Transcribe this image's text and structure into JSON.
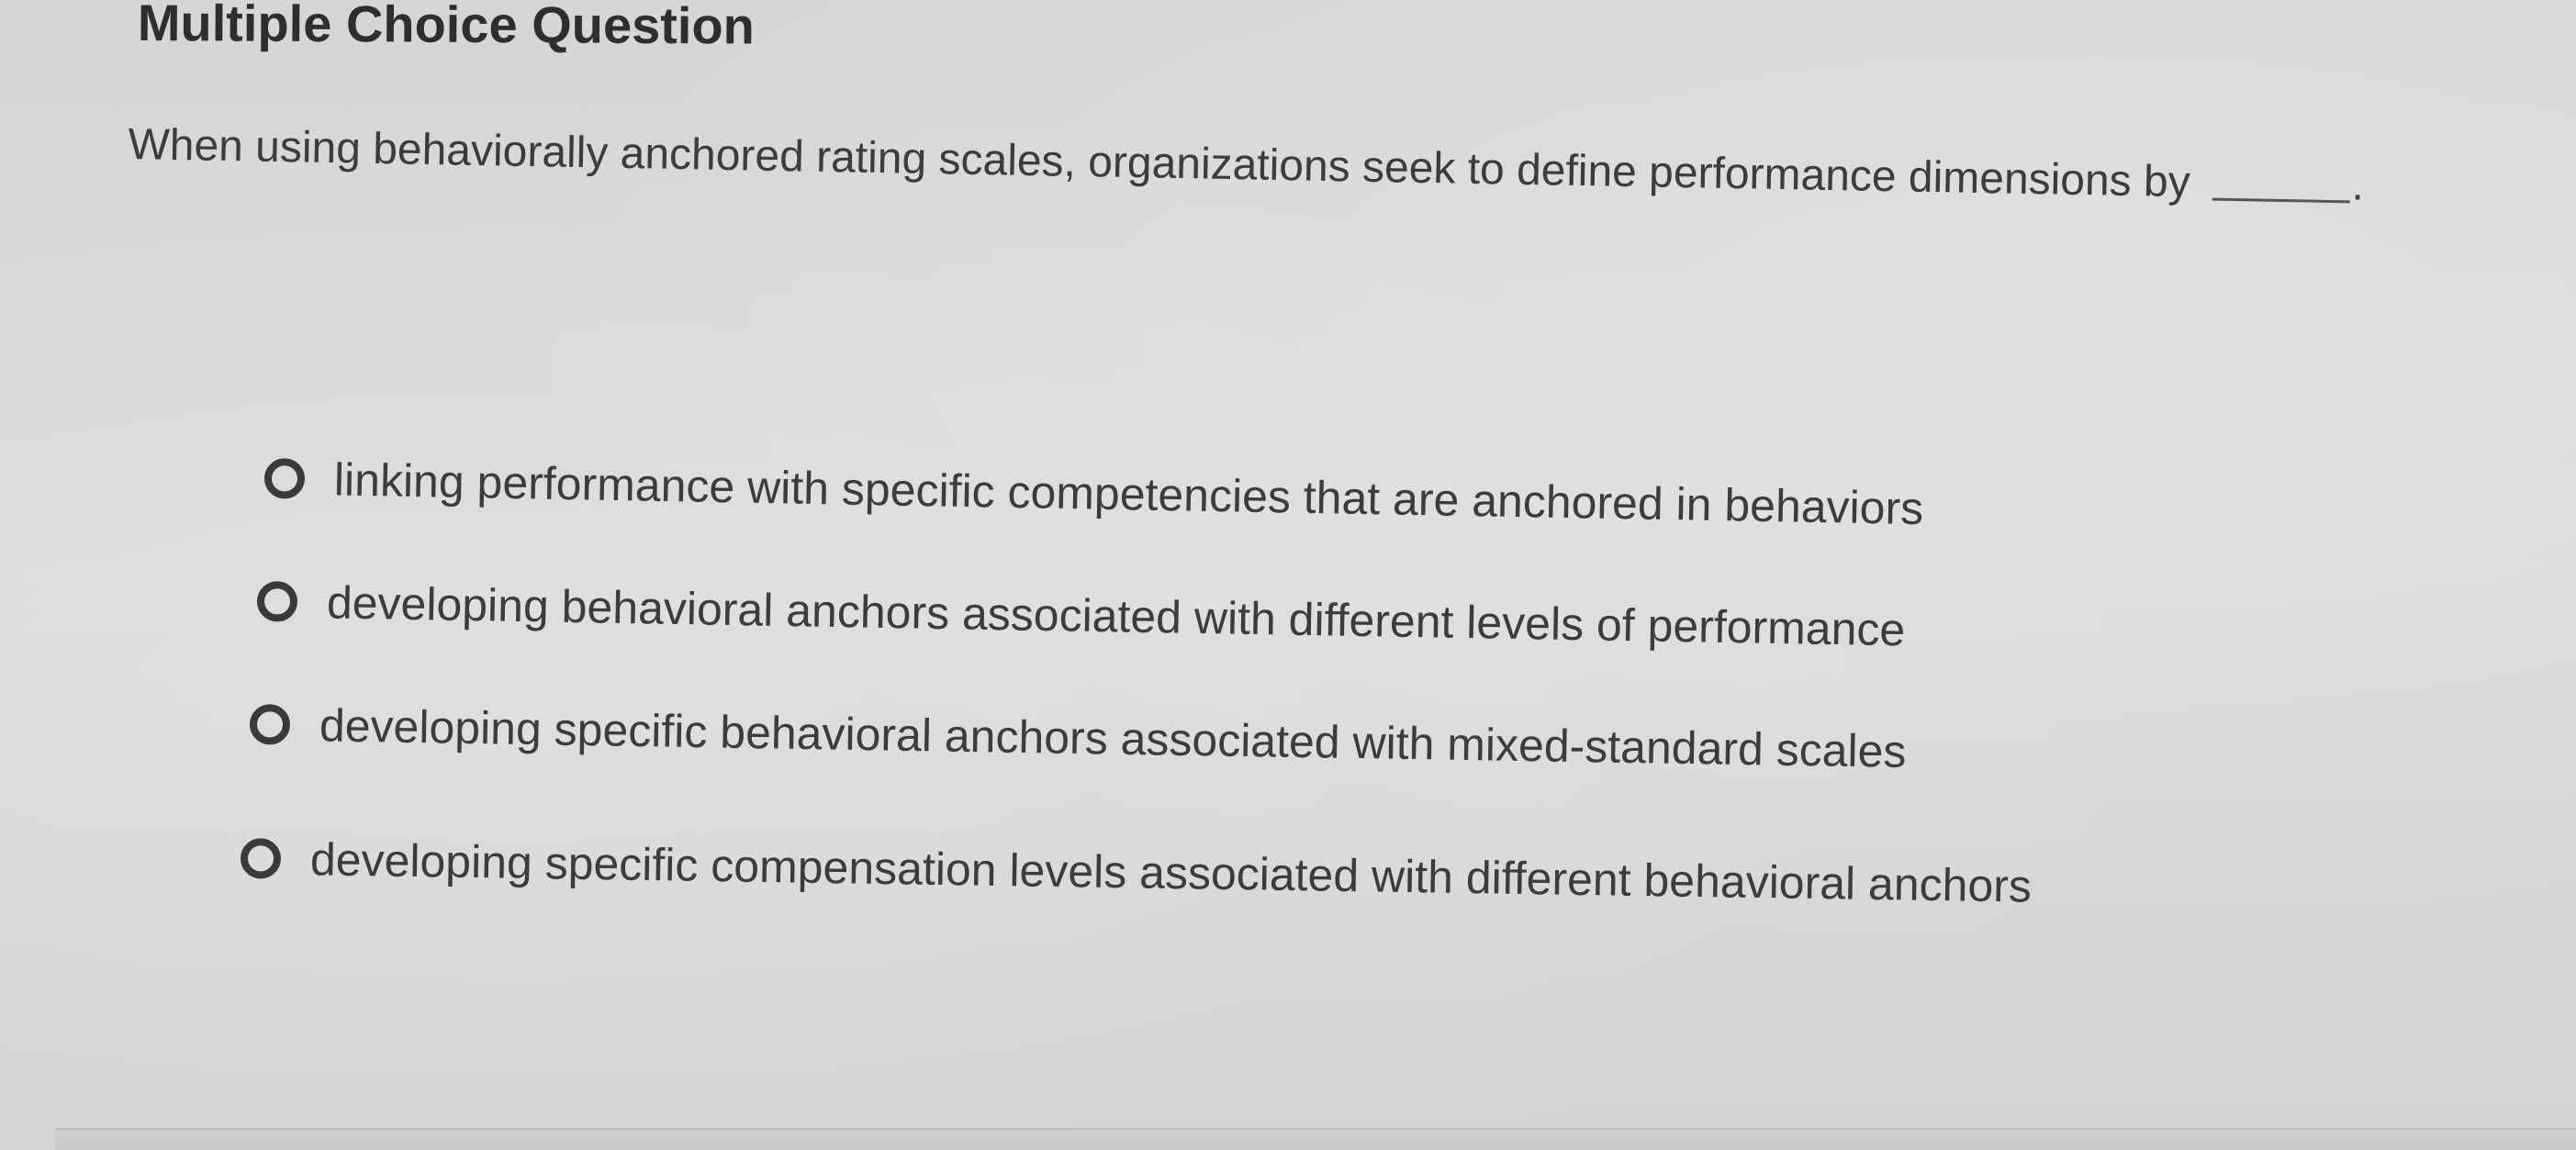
{
  "header": {
    "title": "Multiple Choice Question"
  },
  "question": {
    "text": "When using behaviorally anchored rating scales, organizations seek to define performance dimensions by",
    "end": "."
  },
  "options": [
    {
      "label": "linking performance with specific competencies that are anchored in behaviors",
      "selected": false
    },
    {
      "label": "developing behavioral anchors associated with different levels of performance",
      "selected": false
    },
    {
      "label": "developing specific behavioral anchors associated with mixed-standard scales",
      "selected": false
    },
    {
      "label": "developing specific compensation levels associated with different behavioral anchors",
      "selected": false
    }
  ]
}
